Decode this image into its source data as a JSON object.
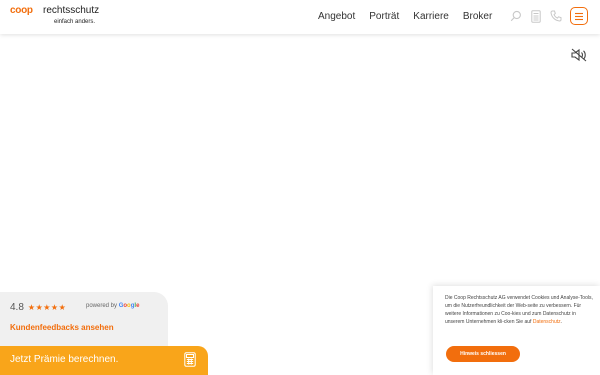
{
  "header": {
    "logo": {
      "brand": "coop",
      "name": "rechtsschutz",
      "tagline": "einfach anders."
    },
    "nav": [
      {
        "label": "Angebot"
      },
      {
        "label": "Porträt"
      },
      {
        "label": "Karriere"
      },
      {
        "label": "Broker"
      }
    ],
    "icons": [
      "search-icon",
      "calculator-icon",
      "phone-icon",
      "menu-icon"
    ]
  },
  "video": {
    "mute_icon": "speaker-muted-icon"
  },
  "rating": {
    "score": "4.8",
    "stars": "★★★★★",
    "powered_by": "powered by",
    "google": [
      "G",
      "o",
      "o",
      "g",
      "l",
      "e"
    ],
    "feedback_link": "Kundenfeedbacks ansehen"
  },
  "cta": {
    "label": "Jetzt Prämie berechnen.",
    "icon": "calculator-icon"
  },
  "cookie": {
    "text": "Die Coop Rechtsschutz AG verwendet Cookies und Analyse-Tools, um die Nutzerfreundlichkeit der Web-seite zu verbessern. Für weitere Informationen zu Coo-kies und zum Datenschutz in unserem Unternehmen kli-cken Sie auf ",
    "link": "Datenschutz",
    "link_suffix": ".",
    "button": "Hinweis schliessen"
  },
  "colors": {
    "brand_orange": "#f26e0d",
    "cta_yellow": "#f9a51a",
    "panel_gray": "#f0f0f0"
  }
}
